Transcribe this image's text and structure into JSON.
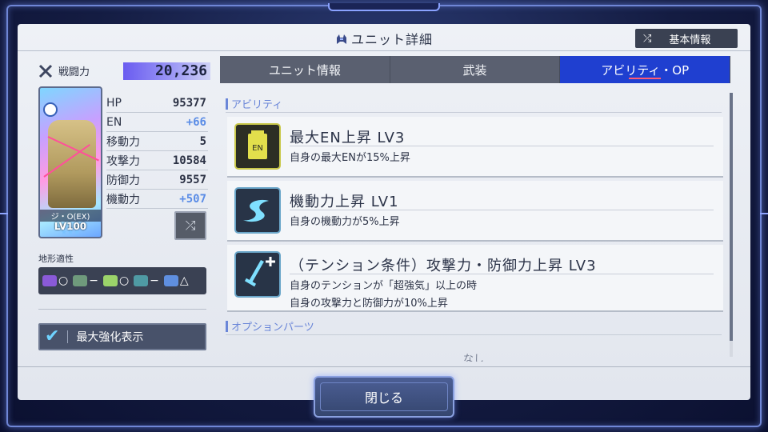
{
  "window": {
    "title": "ユニット詳細",
    "basic_info_label": "基本情報"
  },
  "left": {
    "power_label": "戦闘力",
    "power_value": "20,236",
    "unit": {
      "name": "ジ・O(EX)",
      "level": "LV100",
      "stars": "★★★"
    },
    "stats": [
      {
        "key": "HP",
        "value": "95377",
        "bonus": false
      },
      {
        "key": "EN",
        "value": "+66",
        "bonus": true
      },
      {
        "key": "移動力",
        "value": "5",
        "bonus": false
      },
      {
        "key": "攻撃力",
        "value": "10584",
        "bonus": false
      },
      {
        "key": "防御力",
        "value": "9557",
        "bonus": false
      },
      {
        "key": "機動力",
        "value": "+507",
        "bonus": true
      }
    ],
    "terrain_label": "地形適性",
    "terrain": [
      {
        "icon": "space-icon",
        "grade": "○",
        "color": "#8a5ad8"
      },
      {
        "icon": "air-icon",
        "grade": "−",
        "color": "#6f9a7c"
      },
      {
        "icon": "land-icon",
        "grade": "○",
        "color": "#9bd36a"
      },
      {
        "icon": "water-icon",
        "grade": "−",
        "color": "#4f9aa4"
      },
      {
        "icon": "underground-icon",
        "grade": "△",
        "color": "#5f8fe0"
      }
    ],
    "max_enhance_label": "最大強化表示"
  },
  "tabs": [
    {
      "label": "ユニット情報",
      "active": false
    },
    {
      "label": "武装",
      "active": false
    },
    {
      "label": "アビリティ・OP",
      "active": true
    }
  ],
  "abilities_section": "アビリティ",
  "abilities": [
    {
      "icon": "en-tank-icon",
      "title": "最大EN上昇 LV3",
      "desc": [
        "自身の最大ENが15%上昇"
      ]
    },
    {
      "icon": "swoosh-icon",
      "title": "機動力上昇 LV1",
      "desc": [
        "自身の機動力が5%上昇"
      ]
    },
    {
      "icon": "sword-plus-icon",
      "title": "（テンション条件）攻撃力・防御力上昇 LV3",
      "desc": [
        "自身のテンションが「超強気」以上の時",
        "自身の攻撃力と防御力が10%上昇"
      ]
    }
  ],
  "option_section": "オプションパーツ",
  "option_none": "なし",
  "close_label": "閉じる",
  "colors": {
    "accent_tab": "#1f3fd0",
    "bonus_blue": "#5a8ce6",
    "frame": "#6f86d6"
  }
}
